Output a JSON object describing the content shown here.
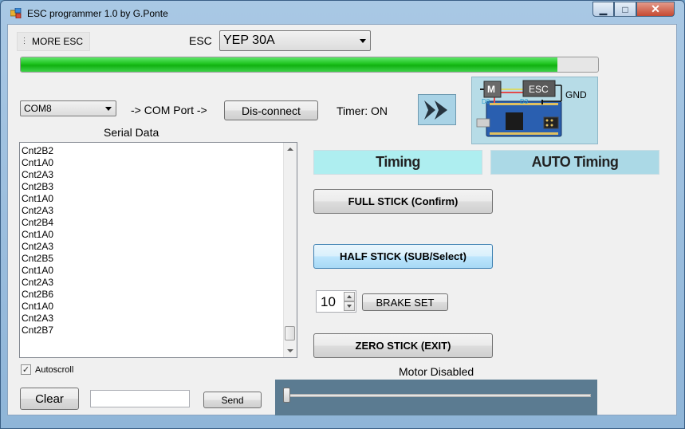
{
  "window": {
    "title": "ESC programmer 1.0 by G.Ponte",
    "minimize_glyph": "▁",
    "maximize_glyph": "□",
    "close_glyph": "✕"
  },
  "toolbar": {
    "more_esc_label": "MORE ESC"
  },
  "esc": {
    "label": "ESC",
    "selected": "YEP 30A"
  },
  "progress": {
    "value_fraction": 0.93,
    "color": "#1ec41e"
  },
  "connection": {
    "com_selected": "COM8",
    "com_port_label": "-> COM Port ->",
    "disconnect_label": "Dis-connect",
    "timer_label": "Timer: ON"
  },
  "diagram": {
    "motor_label": "M",
    "esc_label": "ESC",
    "gnd_label": "GND",
    "pin_d8": "D8",
    "pin_d3": "D3"
  },
  "serial": {
    "label": "Serial Data",
    "lines": [
      "Cnt2B2",
      "Cnt1A0",
      "Cnt2A3",
      "Cnt2B3",
      "Cnt1A0",
      "Cnt2A3",
      "Cnt2B4",
      "Cnt1A0",
      "Cnt2A3",
      "Cnt2B5",
      "Cnt1A0",
      "Cnt2A3",
      "Cnt2B6",
      "Cnt1A0",
      "Cnt2A3",
      "Cnt2B7"
    ],
    "autoscroll_label": "Autoscroll",
    "autoscroll_checked": true,
    "check_glyph": "✓"
  },
  "send": {
    "clear_label": "Clear",
    "input_value": "",
    "send_label": "Send"
  },
  "timing": {
    "timing_label": "Timing",
    "auto_timing_label": "AUTO Timing"
  },
  "sticks": {
    "full_label": "FULL STICK (Confirm)",
    "half_label": "HALF STICK (SUB/Select)",
    "zero_label": "ZERO STICK (EXIT)"
  },
  "brake": {
    "value": "10",
    "set_label": "BRAKE SET"
  },
  "motor": {
    "status": "Motor Disabled",
    "slider_value_fraction": 0.0
  }
}
